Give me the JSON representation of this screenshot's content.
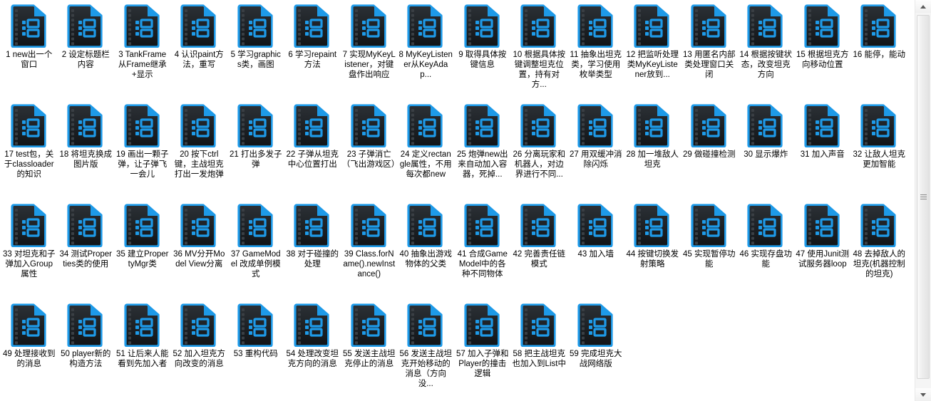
{
  "window": {
    "title": "Video files grid",
    "background_color": "#ffffff",
    "text_color": "#000000",
    "icon_accent_color": "#1e9ae8",
    "icon_body_color": "#1f2225"
  },
  "scrollbar": {
    "orientation": "vertical",
    "up_arrow": "▲",
    "down_arrow": "▼",
    "grip": "≡"
  },
  "files": [
    {
      "index": 1,
      "label": "1 new出一个窗口"
    },
    {
      "index": 2,
      "label": "2 设定标题栏内容"
    },
    {
      "index": 3,
      "label": "3 TankFrame从Frame继承+显示"
    },
    {
      "index": 4,
      "label": "4 认识paint方法，重写"
    },
    {
      "index": 5,
      "label": "5 学习graphics类，画图"
    },
    {
      "index": 6,
      "label": "6 学习repaint方法"
    },
    {
      "index": 7,
      "label": "7 实现MyKeyListener，对键盘作出响应"
    },
    {
      "index": 8,
      "label": "8 MyKeyListener从KeyAdap..."
    },
    {
      "index": 9,
      "label": "9 取得具体按键信息"
    },
    {
      "index": 10,
      "label": "10 根据具体按键调整坦克位置，持有对方..."
    },
    {
      "index": 11,
      "label": "11 抽象出坦克类，学习使用枚举类型"
    },
    {
      "index": 12,
      "label": "12 把监听处理类MyKeyListener放到..."
    },
    {
      "index": 13,
      "label": "13 用匿名内部类处理窗口关闭"
    },
    {
      "index": 14,
      "label": "14 根据按键状态，改变坦克方向"
    },
    {
      "index": 15,
      "label": "15 根据坦克方向移动位置"
    },
    {
      "index": 16,
      "label": "16 能停，能动"
    },
    {
      "index": 17,
      "label": "17 test包，关于classloader的知识"
    },
    {
      "index": 18,
      "label": "18 将坦克换成图片版"
    },
    {
      "index": 19,
      "label": "19 画出一颗子弹，让子弹飞一会儿"
    },
    {
      "index": 20,
      "label": "20 按下ctrl键，主战坦克打出一发炮弹"
    },
    {
      "index": 21,
      "label": "21 打出多发子弹"
    },
    {
      "index": 22,
      "label": "22 子弹从坦克中心位置打出"
    },
    {
      "index": 23,
      "label": "23 子弹消亡（飞出游戏区）"
    },
    {
      "index": 24,
      "label": "24 定义rectangle属性，不用每次都new"
    },
    {
      "index": 25,
      "label": "25 炮弹new出来自动加入容器，死掉..."
    },
    {
      "index": 26,
      "label": "26 分离玩家和机器人，对边界进行不同..."
    },
    {
      "index": 27,
      "label": "27 用双缓冲消除闪烁"
    },
    {
      "index": 28,
      "label": "28 加一堆敌人坦克"
    },
    {
      "index": 29,
      "label": "29 做碰撞检测"
    },
    {
      "index": 30,
      "label": "30 显示爆炸"
    },
    {
      "index": 31,
      "label": "31 加入声音"
    },
    {
      "index": 32,
      "label": "32 让敌人坦克更加智能"
    },
    {
      "index": 33,
      "label": "33 对坦克和子弹加入Group属性"
    },
    {
      "index": 34,
      "label": "34 测试Properties类的使用"
    },
    {
      "index": 35,
      "label": "35 建立PropertyMgr类"
    },
    {
      "index": 36,
      "label": "36 MV分开Model View分离"
    },
    {
      "index": 37,
      "label": "37 GameModel 改成单例模式"
    },
    {
      "index": 38,
      "label": "38 对于碰撞的处理"
    },
    {
      "index": 39,
      "label": "39 Class.forName().newInstance()"
    },
    {
      "index": 40,
      "label": "40 抽象出游戏物体的父类"
    },
    {
      "index": 41,
      "label": "41 合成GameModel中的各种不同物体"
    },
    {
      "index": 42,
      "label": "42 完善责任链模式"
    },
    {
      "index": 43,
      "label": "43 加入墙"
    },
    {
      "index": 44,
      "label": "44 按键切换发射策略"
    },
    {
      "index": 45,
      "label": "45 实现暂停功能"
    },
    {
      "index": 46,
      "label": "46 实现存盘功能"
    },
    {
      "index": 47,
      "label": "47 使用Junit测试服务器loop"
    },
    {
      "index": 48,
      "label": "48 去掉敌人的坦克(机器控制的坦克)"
    },
    {
      "index": 49,
      "label": "49 处理接收到的消息"
    },
    {
      "index": 50,
      "label": "50 player新的构造方法"
    },
    {
      "index": 51,
      "label": "51 让后来人能看到先加入者"
    },
    {
      "index": 52,
      "label": "52 加入坦克方向改变的消息"
    },
    {
      "index": 53,
      "label": "53 重构代码"
    },
    {
      "index": 54,
      "label": "54 处理改变坦克方向的消息"
    },
    {
      "index": 55,
      "label": "55 发送主战坦克停止的消息"
    },
    {
      "index": 56,
      "label": "56 发送主战坦克开始移动的消息（方向没..."
    },
    {
      "index": 57,
      "label": "57 加入子弹和Player的撞击逻辑"
    },
    {
      "index": 58,
      "label": "58 把主战坦克也加入到List中"
    },
    {
      "index": 59,
      "label": "59 完成坦克大战网络版"
    }
  ]
}
